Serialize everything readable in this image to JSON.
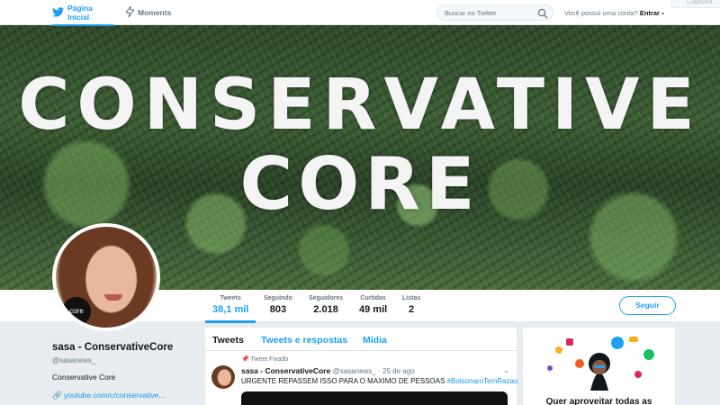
{
  "nav": {
    "home": "Página Inicial",
    "moments": "Moments",
    "search_placeholder": "Buscar no Twitter",
    "account_prompt": "Você possui uma conta?",
    "login": "Entrar",
    "capture": "Captura"
  },
  "banner": {
    "line1": "CONSERVATIVE",
    "line2": "CORE"
  },
  "avatar_logo": "core",
  "stats": [
    {
      "label": "Tweets",
      "value": "38,1 mil"
    },
    {
      "label": "Seguindo",
      "value": "803"
    },
    {
      "label": "Seguidores",
      "value": "2.018"
    },
    {
      "label": "Curtidas",
      "value": "49 mil"
    },
    {
      "label": "Listas",
      "value": "2"
    }
  ],
  "follow_button": "Seguir",
  "profile": {
    "name": "sasa - ConservativeCore",
    "handle": "@sasanews_",
    "bio": "Conservative Core",
    "link": "youtube.com/c/conservative..."
  },
  "timeline": {
    "tabs": [
      "Tweets",
      "Tweets e respostas",
      "Mídia"
    ],
    "tweet": {
      "pinned_label": "Tweet Fixado",
      "author": "sasa - ConservativeCore",
      "handle": "@sasanews_",
      "date": "· 25 de ago",
      "text": "URGENTE REPASSEM ISSO PARA O MAXIMO DE PESSOAS",
      "hashtag": "#BolsonaroTemRazao"
    }
  },
  "promo": {
    "text": "Quer aproveitar todas as"
  },
  "colors": {
    "accent": "#1da1f2",
    "link": "#1b95e0",
    "text": "#14171a",
    "muted": "#657786"
  }
}
